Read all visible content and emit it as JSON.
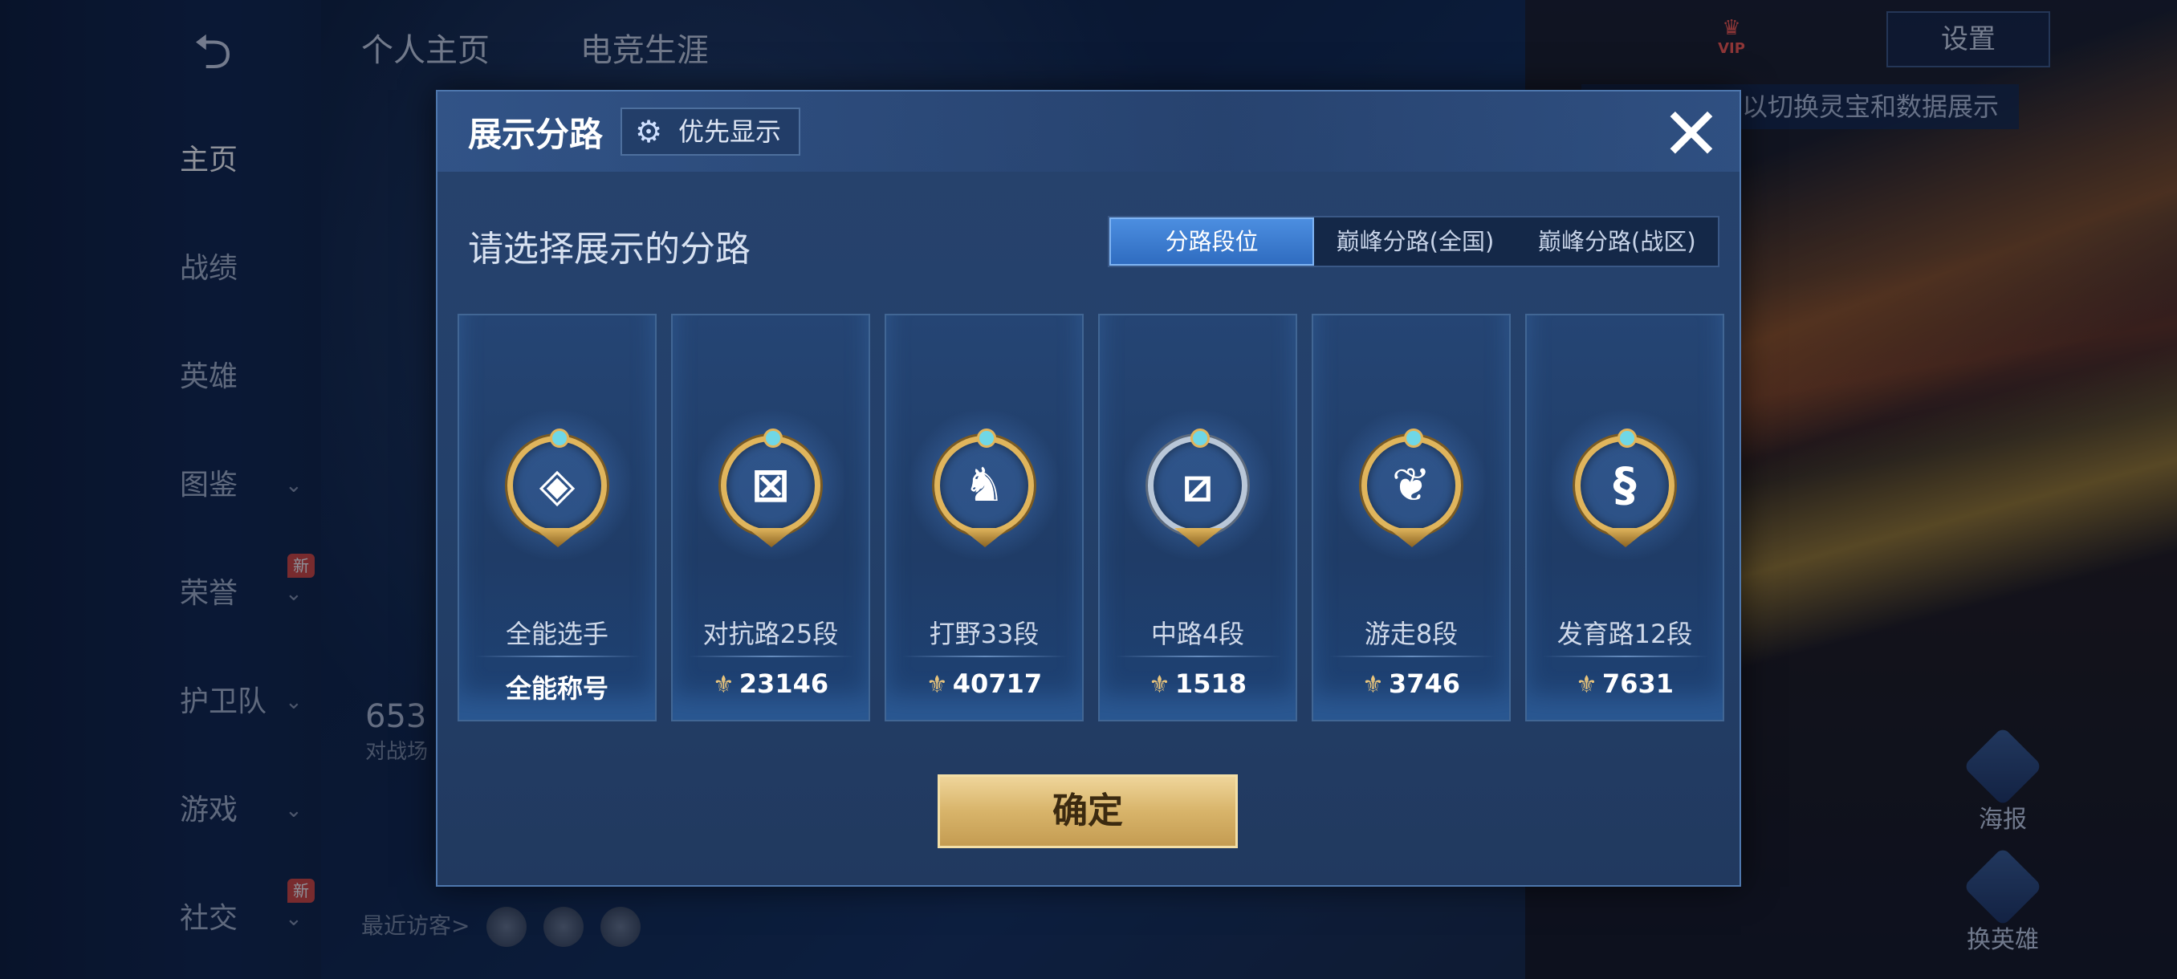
{
  "background": {
    "top_tabs": [
      "个人主页",
      "电竞生涯"
    ],
    "nav": [
      {
        "label": "主页",
        "active": true,
        "chevron": false,
        "new": false
      },
      {
        "label": "战绩",
        "active": false,
        "chevron": false,
        "new": false
      },
      {
        "label": "英雄",
        "active": false,
        "chevron": false,
        "new": false
      },
      {
        "label": "图鉴",
        "active": false,
        "chevron": true,
        "new": false
      },
      {
        "label": "荣誉",
        "active": false,
        "chevron": true,
        "new": true
      },
      {
        "label": "护卫队",
        "active": false,
        "chevron": true,
        "new": false
      },
      {
        "label": "游戏",
        "active": false,
        "chevron": true,
        "new": false
      },
      {
        "label": "社交",
        "active": false,
        "chevron": true,
        "new": true
      }
    ],
    "new_badge": "新",
    "vip_label": "VIP",
    "settings_label": "设置",
    "hint_text": "以切换灵宝和数据展示",
    "visitors_label": "最近访客>",
    "poster_label": "海报",
    "switch_hero_label": "换英雄",
    "stat_value": "653",
    "stat_caption": "对战场"
  },
  "modal": {
    "title": "展示分路",
    "priority_button": "优先显示",
    "subtitle": "请选择展示的分路",
    "tabs": [
      {
        "label": "分路段位",
        "active": true
      },
      {
        "label": "巅峰分路(全国)",
        "active": false
      },
      {
        "label": "巅峰分路(战区)",
        "active": false
      }
    ],
    "cards": [
      {
        "name": "全能选手",
        "score": "全能称号",
        "has_points": false,
        "medal_icon": "all-round-medal-icon",
        "medal_style": "gold",
        "glyph": "◈"
      },
      {
        "name": "对抗路25段",
        "score": "23146",
        "has_points": true,
        "medal_icon": "clash-lane-medal-icon",
        "medal_style": "gold",
        "glyph": "⊠"
      },
      {
        "name": "打野33段",
        "score": "40717",
        "has_points": true,
        "medal_icon": "jungle-medal-icon",
        "medal_style": "gold",
        "glyph": "♞"
      },
      {
        "name": "中路4段",
        "score": "1518",
        "has_points": true,
        "medal_icon": "mid-lane-medal-icon",
        "medal_style": "silver",
        "glyph": "⧄"
      },
      {
        "name": "游走8段",
        "score": "3746",
        "has_points": true,
        "medal_icon": "roam-medal-icon",
        "medal_style": "gold",
        "glyph": "❦"
      },
      {
        "name": "发育路12段",
        "score": "7631",
        "has_points": true,
        "medal_icon": "farm-lane-medal-icon",
        "medal_style": "gold",
        "glyph": "§"
      }
    ],
    "confirm_label": "确定"
  },
  "colors": {
    "accent_blue": "#3f7fd6",
    "confirm_gold": "#d8b46a",
    "points_gold": "#e8c47c"
  }
}
